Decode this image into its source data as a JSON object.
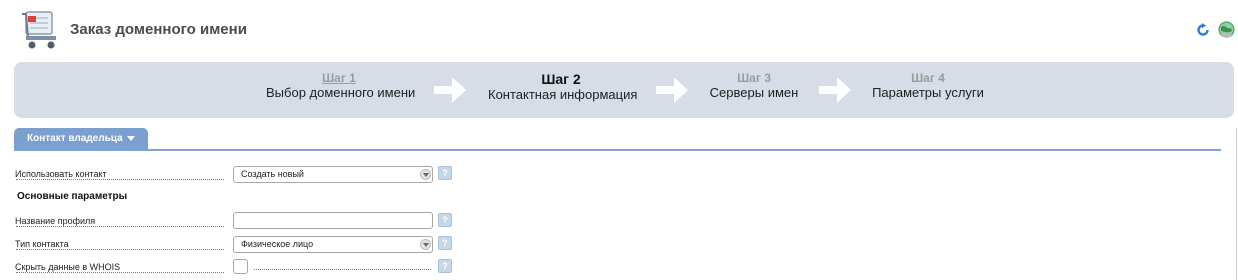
{
  "header": {
    "title": "Заказ доменного имени",
    "icon": "shopping-cart-icon",
    "actions": [
      {
        "icon": "refresh-icon",
        "color": "#2a7fd6"
      },
      {
        "icon": "globe-icon",
        "color": "#4aa864"
      }
    ]
  },
  "steps": [
    {
      "number": "Шаг 1",
      "label": "Выбор доменного имени",
      "state": "done"
    },
    {
      "number": "Шаг 2",
      "label": "Контактная информация",
      "state": "active"
    },
    {
      "number": "Шаг 3",
      "label": "Серверы имен",
      "state": "pending"
    },
    {
      "number": "Шаг 4",
      "label": "Параметры услуги",
      "state": "pending"
    }
  ],
  "tab": {
    "label": "Контакт владельца",
    "icon": "chevron-down-icon"
  },
  "form": {
    "use_contact": {
      "label": "Использовать контакт",
      "value": "Создать новый"
    },
    "section_title": "Основные параметры",
    "profile_name": {
      "label": "Название профиля",
      "value": ""
    },
    "contact_type": {
      "label": "Тип контакта",
      "value": "Физическое лицо"
    },
    "hide_whois": {
      "label": "Скрыть данные в WHOIS",
      "checked": false
    },
    "help_label": "?"
  },
  "colors": {
    "steps_bg": "#d6dde6",
    "tab_bg": "#7ba0d0",
    "accent_line": "#7fa3cf"
  }
}
